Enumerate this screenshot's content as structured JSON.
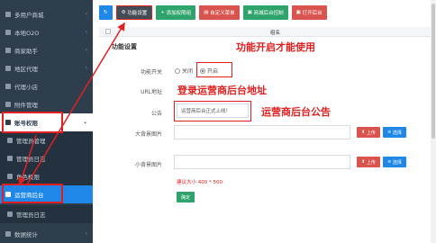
{
  "sidebar": {
    "items": [
      {
        "label": "多用户商城",
        "icon": "store-icon"
      },
      {
        "label": "本地O2O",
        "icon": "location-icon"
      },
      {
        "label": "商家助手",
        "icon": "handshake-icon"
      },
      {
        "label": "地区代理",
        "icon": "map-pin-icon"
      },
      {
        "label": "代理小店",
        "icon": "shop-icon"
      },
      {
        "label": "附件管理",
        "icon": "paperclip-icon"
      },
      {
        "label": "账号权限",
        "icon": "key-icon"
      },
      {
        "label": "管理员管理",
        "icon": "user-icon"
      },
      {
        "label": "管理员日志",
        "icon": "user-log-icon"
      },
      {
        "label": "角色权限",
        "icon": "role-icon"
      },
      {
        "label": "运营商后台",
        "icon": "server-icon"
      },
      {
        "label": "管理员日志",
        "icon": "log-icon"
      },
      {
        "label": "数据统计",
        "icon": "chart-icon"
      }
    ]
  },
  "toolbar": {
    "refresh_label": "↻",
    "settings_label": "功能设置",
    "add_label": "添加权限组",
    "custom_label": "自定义菜单",
    "backend_label": "商城后台控制",
    "open_label": "打开后台"
  },
  "table": {
    "header_name": "组名"
  },
  "form": {
    "title": "功能设置",
    "switch_label": "功能开关",
    "option_off": "关闭",
    "option_on": "开启",
    "url_label": "URL地址",
    "notice_label": "公告",
    "notice_value": "运营商后台正式上线！",
    "large_logo_label": "大背景图片",
    "small_logo_label": "小背景图片",
    "upload_label": "上传",
    "choose_label": "选择",
    "size_hint": "建议大小 400 * 500",
    "confirm_label": "确定"
  },
  "annotations": {
    "switch_note": "功能开启才能使用",
    "url_note": "登录运营商后台地址",
    "notice_note": "运营商后台公告"
  },
  "colors": {
    "sidebar_bg": "#2f3e4d",
    "accent_blue": "#1e87e8",
    "annotation_red": "#e02020"
  }
}
